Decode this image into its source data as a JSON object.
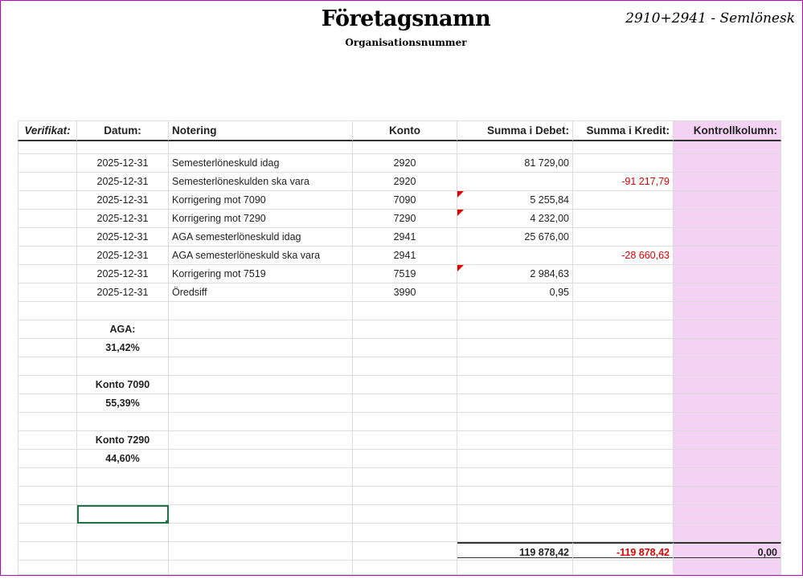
{
  "header": {
    "company": "Företagsnamn",
    "org_number": "Organisationsnummer",
    "doc_label": "2910+2941 - Semlönesk"
  },
  "columns": {
    "verifikat": "Verifikat:",
    "datum": "Datum:",
    "notering": "Notering",
    "konto": "Konto",
    "debet": "Summa i Debet:",
    "kredit": "Summa i Kredit:",
    "kontroll": "Kontrollkolumn:"
  },
  "rows": [
    {
      "datum": "2025-12-31",
      "notering": "Semesterlöneskuld idag",
      "konto": "2920",
      "debet": "81 729,00",
      "kredit": ""
    },
    {
      "datum": "2025-12-31",
      "notering": "Semesterlöneskulden ska vara",
      "konto": "2920",
      "debet": "",
      "kredit": "-91 217,79"
    },
    {
      "datum": "2025-12-31",
      "notering": "Korrigering mot 7090",
      "konto": "7090",
      "debet": "5 255,84",
      "kredit": ""
    },
    {
      "datum": "2025-12-31",
      "notering": "Korrigering mot 7290",
      "konto": "7290",
      "debet": "4 232,00",
      "kredit": ""
    },
    {
      "datum": "2025-12-31",
      "notering": "AGA semesterlöneskuld idag",
      "konto": "2941",
      "debet": "25 676,00",
      "kredit": ""
    },
    {
      "datum": "2025-12-31",
      "notering": "AGA semesterlöneskuld ska vara",
      "konto": "2941",
      "debet": "",
      "kredit": "-28 660,63"
    },
    {
      "datum": "2025-12-31",
      "notering": "Korrigering mot 7519",
      "konto": "7519",
      "debet": "2 984,63",
      "kredit": ""
    },
    {
      "datum": "2025-12-31",
      "notering": "Öredsiff",
      "konto": "3990",
      "debet": "0,95",
      "kredit": ""
    }
  ],
  "rates": {
    "aga_label": "AGA:",
    "aga_value": "31,42%",
    "konto7090_label": "Konto 7090",
    "konto7090_value": "55,39%",
    "konto7290_label": "Konto 7290",
    "konto7290_value": "44,60%"
  },
  "totals": {
    "debet": "119 878,42",
    "kredit": "-119 878,42",
    "kontroll": "0,00"
  },
  "colors": {
    "control_column": "#f4d2f4",
    "negative": "#e00000",
    "selection": "#1e7145",
    "frame": "#c000c0"
  }
}
